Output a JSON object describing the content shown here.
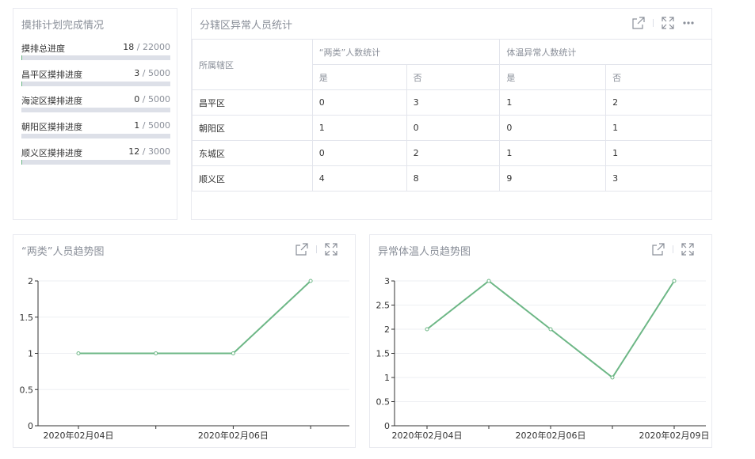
{
  "plan": {
    "title": "摸排计划完成情况",
    "rows": [
      {
        "label": "摸排总进度",
        "done": "18",
        "total": "22000",
        "progress": 0.0008
      },
      {
        "label": "昌平区摸排进度",
        "done": "3",
        "total": "5000",
        "progress": 0.0006
      },
      {
        "label": "海淀区摸排进度",
        "done": "0",
        "total": "5000",
        "progress": 0
      },
      {
        "label": "朝阳区摸排进度",
        "done": "1",
        "total": "5000",
        "progress": 0.0002
      },
      {
        "label": "顺义区摸排进度",
        "done": "12",
        "total": "3000",
        "progress": 0.004
      }
    ],
    "separator": "/"
  },
  "abnormal": {
    "title": "分辖区异常人员统计",
    "icons": [
      "external-link-icon",
      "fullscreen-icon",
      "more-icon"
    ],
    "header": {
      "district": "所属辖区",
      "group1": "“两类”人数统计",
      "group2": "体温异常人数统计",
      "yes": "是",
      "no": "否"
    },
    "rows": [
      {
        "district": "昌平区",
        "g1_yes": "0",
        "g1_no": "3",
        "g2_yes": "1",
        "g2_no": "2"
      },
      {
        "district": "朝阳区",
        "g1_yes": "1",
        "g1_no": "0",
        "g2_yes": "0",
        "g2_no": "1"
      },
      {
        "district": "东城区",
        "g1_yes": "0",
        "g1_no": "2",
        "g2_yes": "1",
        "g2_no": "1"
      },
      {
        "district": "顺义区",
        "g1_yes": "4",
        "g1_no": "8",
        "g2_yes": "9",
        "g2_no": "3"
      }
    ]
  },
  "colors": {
    "line": "#6db786",
    "accent": "#8a8f99"
  },
  "chart_data": [
    {
      "type": "line",
      "title": "“两类”人员趋势图",
      "x": [
        "2020年02月04日",
        "",
        "2020年02月06日",
        ""
      ],
      "x_tick_labels": [
        "2020年02月04日",
        "2020年02月06日"
      ],
      "values": [
        1,
        1,
        1,
        2
      ],
      "ylim": [
        0,
        2
      ],
      "yticks": [
        "0",
        "0.5",
        "1",
        "1.5",
        "2"
      ],
      "grid": true
    },
    {
      "type": "line",
      "title": "异常体温人员趋势图",
      "x": [
        "2020年02月04日",
        "",
        "2020年02月06日",
        "",
        "2020年02月09日"
      ],
      "x_tick_labels": [
        "2020年02月04日",
        "2020年02月06日",
        "2020年02月09日"
      ],
      "values": [
        2,
        3,
        2,
        1,
        3
      ],
      "ylim": [
        0,
        3
      ],
      "yticks": [
        "0",
        "0.5",
        "1",
        "1.5",
        "2",
        "2.5",
        "3"
      ],
      "grid": true
    }
  ]
}
